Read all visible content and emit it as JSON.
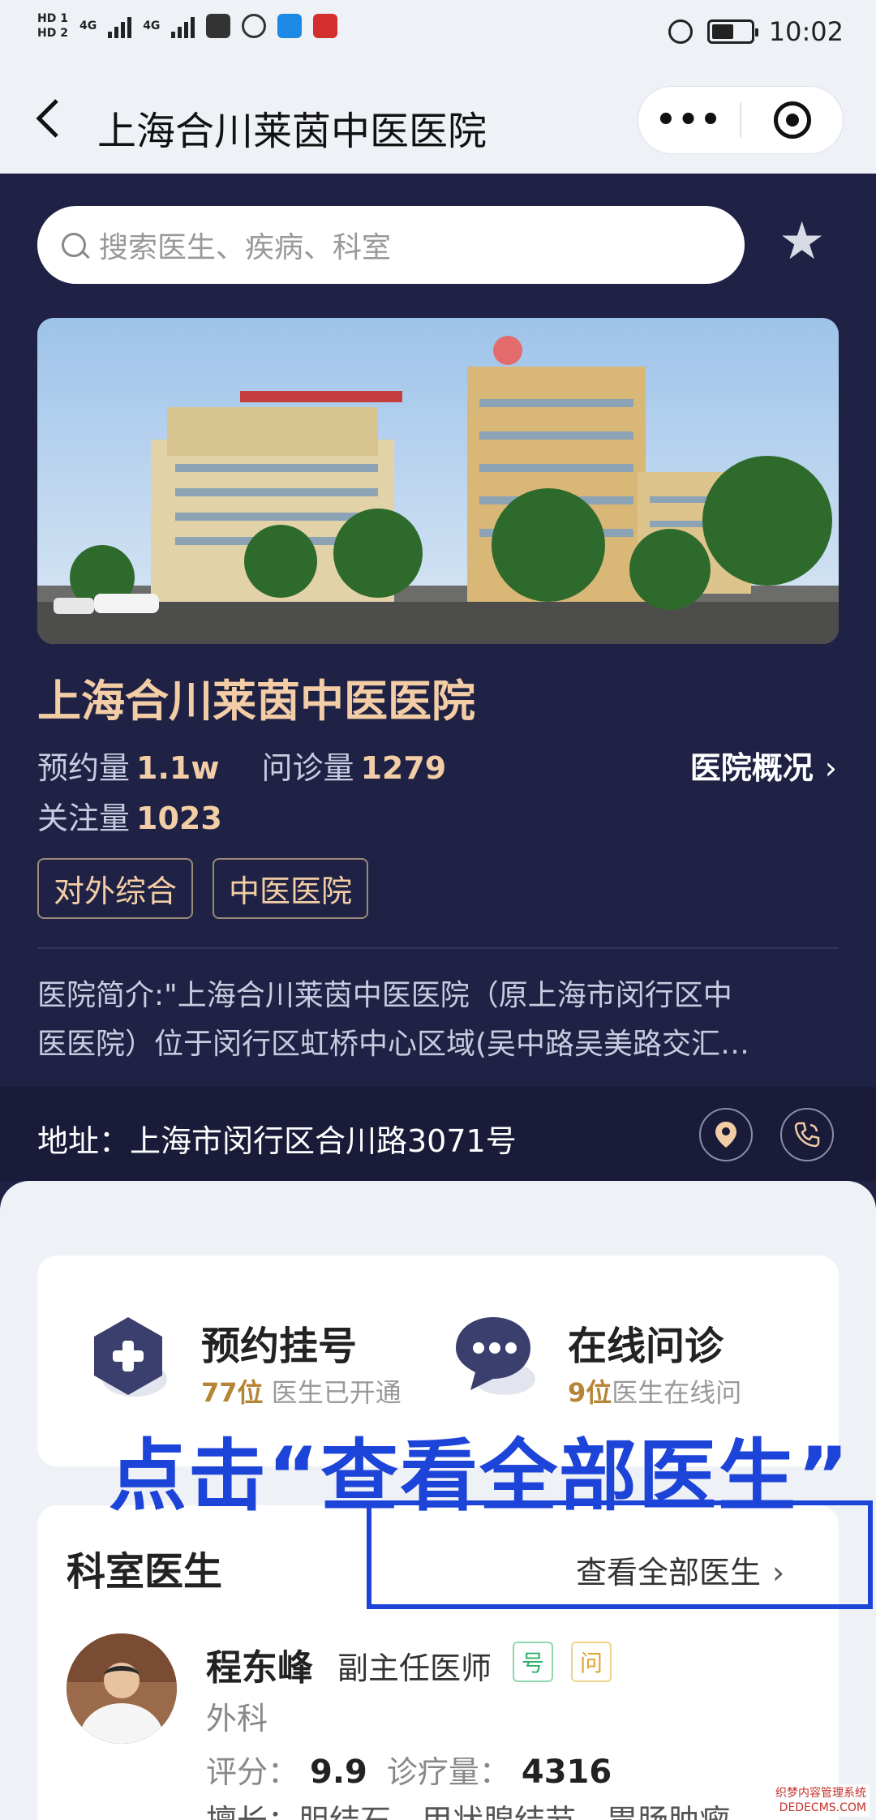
{
  "status_bar": {
    "hd1": "HD 1",
    "hd2": "HD 2",
    "net1": "4G",
    "net2": "4G",
    "time": "10:02",
    "icons": [
      "signal-icon",
      "message-icon",
      "chat-icon",
      "bulb-app-icon",
      "red-app-icon",
      "alarm-icon",
      "battery-icon"
    ]
  },
  "titlebar": {
    "back_icon": "chevron-left-icon",
    "title": "上海合川莱茵中医医院",
    "more_label": "•••"
  },
  "search": {
    "placeholder": "搜索医生、疾病、科室"
  },
  "hospital": {
    "name": "上海合川莱茵中医医院",
    "stats": [
      {
        "label": "预约量",
        "value": "1.1w"
      },
      {
        "label": "问诊量",
        "value": "1279"
      },
      {
        "label": "关注量",
        "value": "1023"
      }
    ],
    "overview_link": "医院概况",
    "tags": [
      "对外综合",
      "中医医院"
    ],
    "intro_line1": "医院简介:\"上海合川莱茵中医医院（原上海市闵行区中",
    "intro_line2": "医医院）位于闵行区虹桥中心区域(吴中路吴美路交汇…",
    "address": "地址：上海市闵行区合川路3071号"
  },
  "services": [
    {
      "title": "预约挂号",
      "count": "77位",
      "desc": "医生已开通"
    },
    {
      "title": "在线问诊",
      "count": "9位",
      "desc": "医生在线问"
    }
  ],
  "annotation": {
    "text": "点击“查看全部医生”"
  },
  "department": {
    "title": "科室医生",
    "view_all": "查看全部医生"
  },
  "doctor": {
    "name": "程东峰",
    "title": "副主任医师",
    "badge_register": "号",
    "badge_consult": "问",
    "dept": "外科",
    "rating_label": "评分：",
    "rating": "9.9",
    "visits_label": "诊疗量：",
    "visits": "4316",
    "skill": "擅长：胆结石、甲状腺结节、胃肠肿瘤"
  },
  "watermark": {
    "line1": "织梦内容管理系统",
    "line2": "DEDECMS.COM"
  },
  "colors": {
    "header_bg": "#1f2244",
    "gold": "#f2cda5",
    "annotation_blue": "#1d44d8"
  }
}
